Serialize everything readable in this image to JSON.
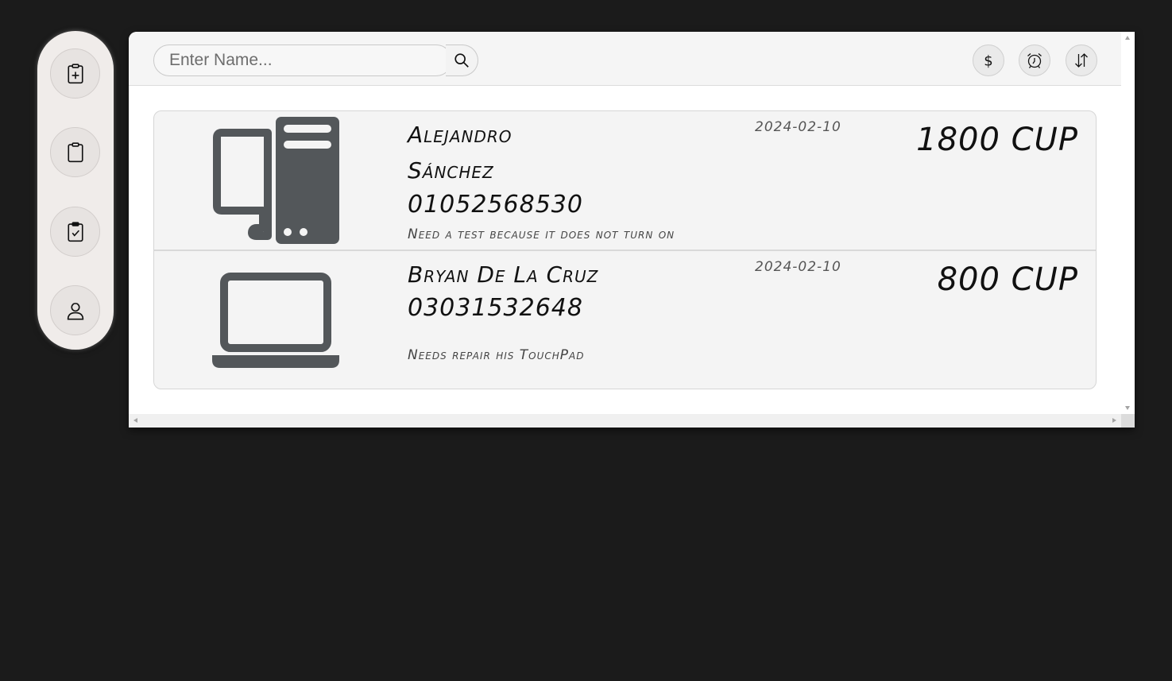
{
  "sidebar": {
    "buttons": [
      {
        "icon": "clipboard-plus-icon"
      },
      {
        "icon": "clipboard-icon"
      },
      {
        "icon": "clipboard-check-icon"
      },
      {
        "icon": "user-icon"
      }
    ]
  },
  "toolbar": {
    "search_placeholder": "Enter Name...",
    "search_icon": "search-icon",
    "sort_price_icon": "dollar-icon",
    "sort_time_icon": "alarm-clock-icon",
    "sort_order_icon": "sort-arrows-icon"
  },
  "orders": [
    {
      "device_icon": "desktop-computer-icon",
      "name_line1": "Alejandro",
      "name_line2": "Sánchez",
      "phone": "01052568530",
      "description": "Need a test because it does not turn on",
      "date": "2024-02-10",
      "price": "1800 CUP"
    },
    {
      "device_icon": "laptop-icon",
      "name_line1": "Bryan De La Cruz",
      "phone": "03031532648",
      "description": "Needs repair his TouchPad",
      "date": "2024-02-10",
      "price": "800 CUP"
    }
  ],
  "colors": {
    "background": "#1b1b1b",
    "icon": "#53575a",
    "card": "#f4f4f4"
  }
}
